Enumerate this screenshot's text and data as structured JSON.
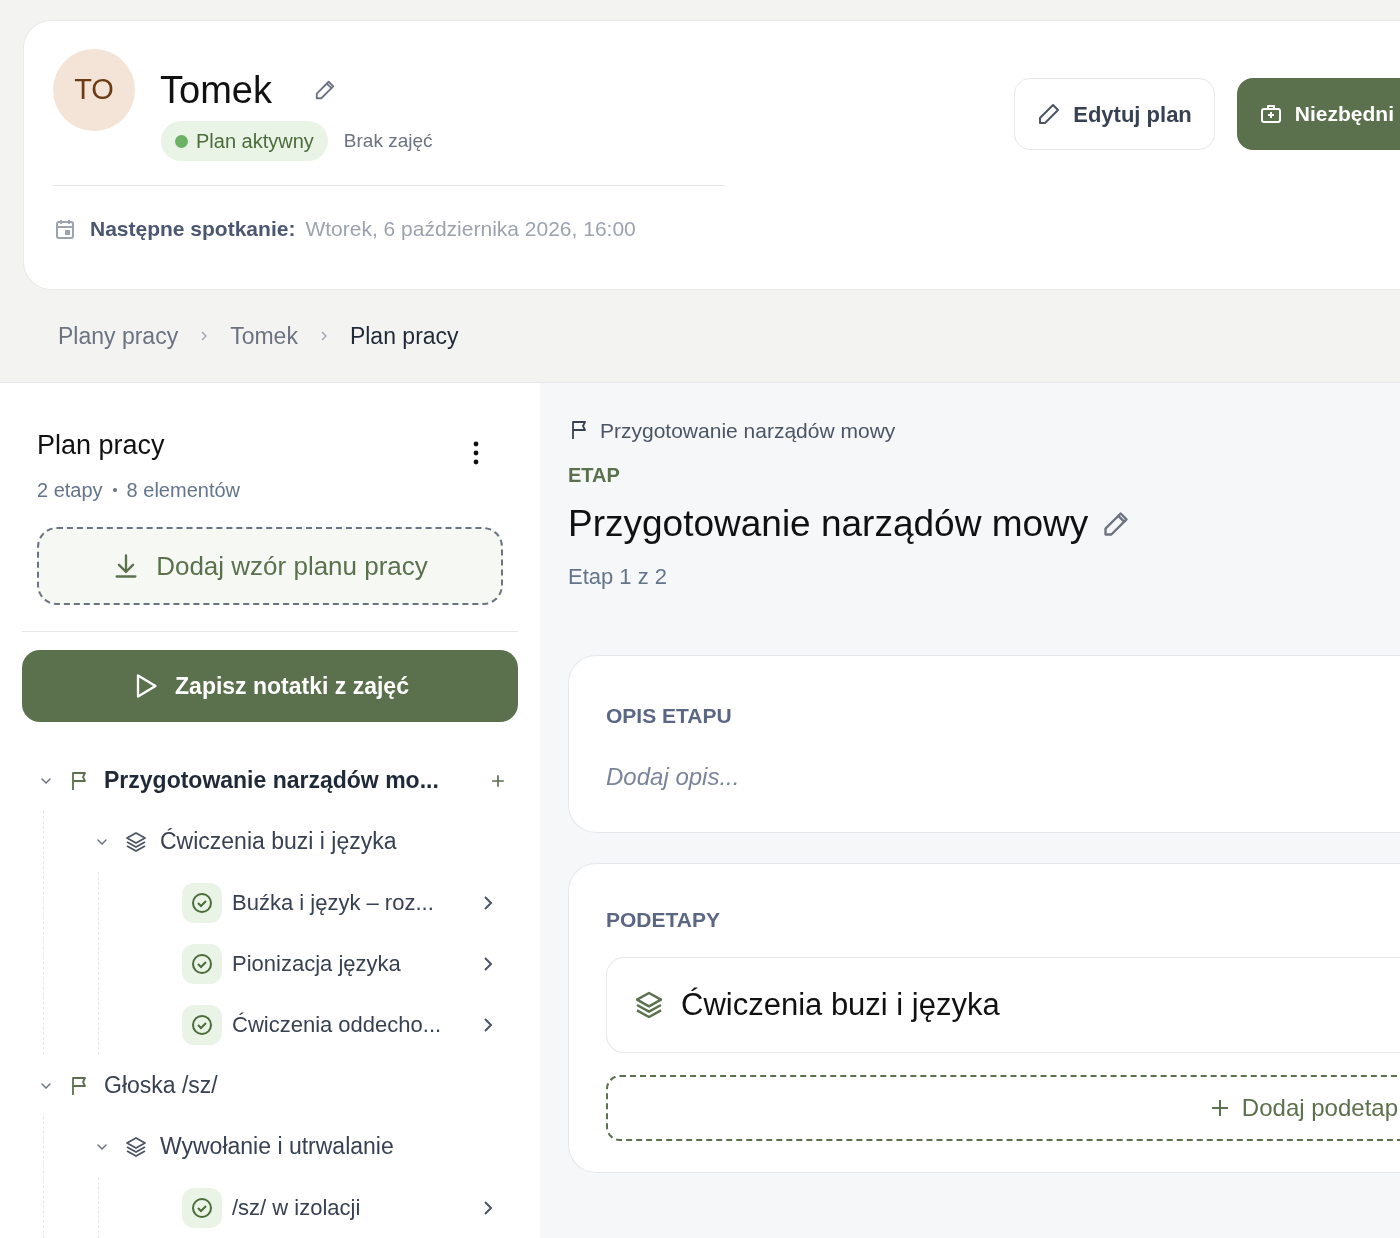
{
  "header": {
    "avatar_initials": "TO",
    "name": "Tomek",
    "status_badge": "Plan aktywny",
    "status_note": "Brak zajęć",
    "next_meeting_label": "Następne spotkanie:",
    "next_meeting_value": "Wtorek, 6 października 2026, 16:00",
    "buttons": [
      {
        "kind": "outline",
        "label": "Edytuj plan"
      },
      {
        "kind": "primary",
        "label": "Niezbędni"
      }
    ]
  },
  "breadcrumbs": [
    {
      "label": "Plany pracy",
      "current": false
    },
    {
      "label": "Tomek",
      "current": false
    },
    {
      "label": "Plan pracy",
      "current": true
    }
  ],
  "sidebar": {
    "title": "Plan pracy",
    "stages_count": "2 etapy",
    "items_count": "8 elementów",
    "template_button": "Dodaj wzór planu pracy",
    "notes_button": "Zapisz notatki z zajęć",
    "tree": [
      {
        "kind": "stage",
        "label": "Przygotowanie narządów mo...",
        "selected": true,
        "expanded": true,
        "children": [
          {
            "kind": "substage",
            "label": "Ćwiczenia buzi i języka",
            "expanded": true,
            "children": [
              {
                "kind": "exercise",
                "label": "Buźka i język – roz..."
              },
              {
                "kind": "exercise",
                "label": "Pionizacja języka"
              },
              {
                "kind": "exercise",
                "label": "Ćwiczenia oddecho..."
              }
            ]
          }
        ]
      },
      {
        "kind": "stage",
        "label": "Głoska /sz/",
        "selected": false,
        "expanded": true,
        "children": [
          {
            "kind": "substage",
            "label": "Wywołanie i utrwalanie",
            "expanded": true,
            "children": [
              {
                "kind": "exercise",
                "label": "/sz/ w izolacji"
              }
            ]
          }
        ]
      }
    ]
  },
  "detail": {
    "crumb": "Przygotowanie narządów mowy",
    "eyebrow": "ETAP",
    "title": "Przygotowanie narządów mowy",
    "subtitle": "Etap 1 z 2",
    "description_heading": "OPIS ETAPU",
    "description_placeholder": "Dodaj opis...",
    "substages_heading": "PODETAPY",
    "substages": [
      "Ćwiczenia buzi i języka"
    ],
    "add_substage_button": "Dodaj podetap"
  }
}
